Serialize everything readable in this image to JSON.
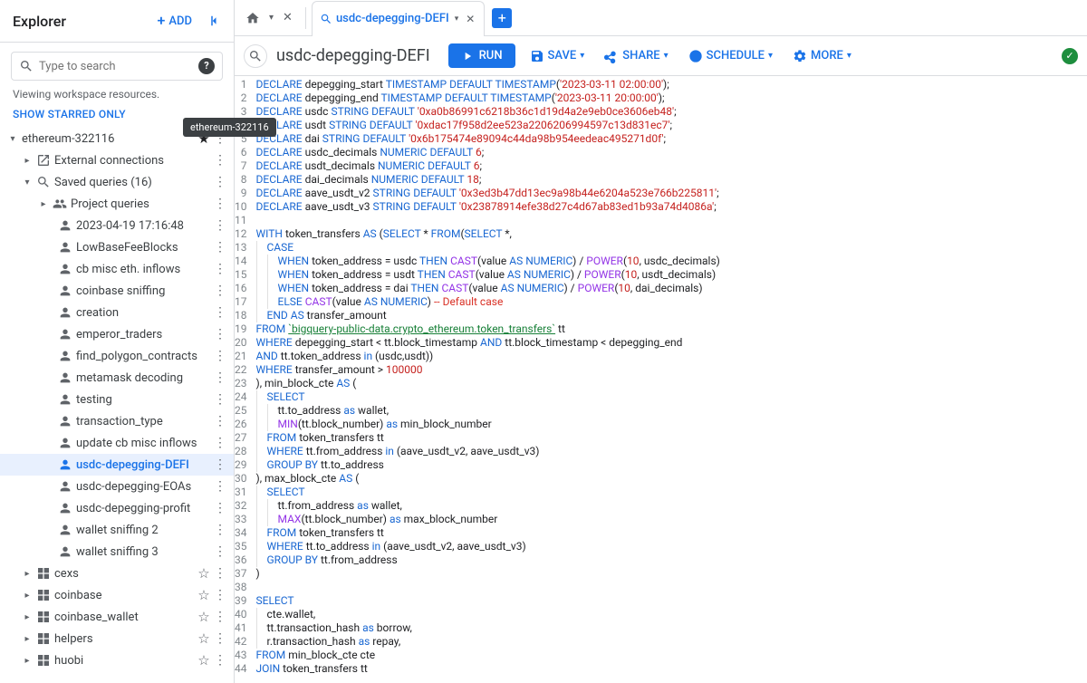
{
  "sidebar": {
    "title": "Explorer",
    "add_label": "ADD",
    "search_placeholder": "Type to search",
    "meta": "Viewing workspace resources.",
    "show_starred": "SHOW STARRED ONLY",
    "tooltip": "ethereum-322116",
    "project": {
      "label": "ethereum-322116",
      "external": "External connections",
      "saved": "Saved queries (16)",
      "proj_queries": "Project queries",
      "queries": [
        "2023-04-19 17:16:48",
        "LowBaseFeeBlocks",
        "cb misc eth. inflows",
        "coinbase sniffing",
        "creation",
        "emperor_traders",
        "find_polygon_contracts",
        "metamask decoding",
        "testing",
        "transaction_type",
        "update cb misc inflows",
        "usdc-depegging-DEFI",
        "usdc-depegging-EOAs",
        "usdc-depegging-profit",
        "wallet sniffing 2",
        "wallet sniffing 3"
      ],
      "datasets": [
        "cexs",
        "coinbase",
        "coinbase_wallet",
        "helpers",
        "huobi"
      ]
    }
  },
  "tab": {
    "label": "usdc-depegging-DEFI"
  },
  "toolbar": {
    "title": "usdc-depegging-DEFI",
    "run": "RUN",
    "save": "SAVE",
    "share": "SHARE",
    "schedule": "SCHEDULE",
    "more": "MORE"
  },
  "code": {
    "lines": [
      [
        [
          "kw",
          "DECLARE"
        ],
        [
          "id",
          " depegging_start "
        ],
        [
          "type",
          "TIMESTAMP"
        ],
        [
          "id",
          " "
        ],
        [
          "kw",
          "DEFAULT"
        ],
        [
          "id",
          " "
        ],
        [
          "type",
          "TIMESTAMP"
        ],
        [
          "id",
          "("
        ],
        [
          "str",
          "'2023-03-11 02:00:00'"
        ],
        [
          "id",
          ");"
        ]
      ],
      [
        [
          "kw",
          "DECLARE"
        ],
        [
          "id",
          " depegging_end "
        ],
        [
          "type",
          "TIMESTAMP"
        ],
        [
          "id",
          " "
        ],
        [
          "kw",
          "DEFAULT"
        ],
        [
          "id",
          " "
        ],
        [
          "type",
          "TIMESTAMP"
        ],
        [
          "id",
          "("
        ],
        [
          "str",
          "'2023-03-11 20:00:00'"
        ],
        [
          "id",
          ");"
        ]
      ],
      [
        [
          "kw",
          "DECLARE"
        ],
        [
          "id",
          " usdc "
        ],
        [
          "type",
          "STRING"
        ],
        [
          "id",
          " "
        ],
        [
          "kw",
          "DEFAULT"
        ],
        [
          "id",
          " "
        ],
        [
          "str",
          "'0xa0b86991c6218b36c1d19d4a2e9eb0ce3606eb48'"
        ],
        [
          "id",
          ";"
        ]
      ],
      [
        [
          "kw",
          "DECLARE"
        ],
        [
          "id",
          " usdt "
        ],
        [
          "type",
          "STRING"
        ],
        [
          "id",
          " "
        ],
        [
          "kw",
          "DEFAULT"
        ],
        [
          "id",
          " "
        ],
        [
          "str",
          "'0xdac17f958d2ee523a2206206994597c13d831ec7'"
        ],
        [
          "id",
          ";"
        ]
      ],
      [
        [
          "kw",
          "DECLARE"
        ],
        [
          "id",
          " dai "
        ],
        [
          "type",
          "STRING"
        ],
        [
          "id",
          " "
        ],
        [
          "kw",
          "DEFAULT"
        ],
        [
          "id",
          " "
        ],
        [
          "str",
          "'0x6b175474e89094c44da98b954eedeac495271d0f'"
        ],
        [
          "id",
          ";"
        ]
      ],
      [
        [
          "kw",
          "DECLARE"
        ],
        [
          "id",
          " usdc_decimals "
        ],
        [
          "type",
          "NUMERIC"
        ],
        [
          "id",
          " "
        ],
        [
          "kw",
          "DEFAULT"
        ],
        [
          "id",
          " "
        ],
        [
          "num",
          "6"
        ],
        [
          "id",
          ";"
        ]
      ],
      [
        [
          "kw",
          "DECLARE"
        ],
        [
          "id",
          " usdt_decimals "
        ],
        [
          "type",
          "NUMERIC"
        ],
        [
          "id",
          " "
        ],
        [
          "kw",
          "DEFAULT"
        ],
        [
          "id",
          " "
        ],
        [
          "num",
          "6"
        ],
        [
          "id",
          ";"
        ]
      ],
      [
        [
          "kw",
          "DECLARE"
        ],
        [
          "id",
          " dai_decimals "
        ],
        [
          "type",
          "NUMERIC"
        ],
        [
          "id",
          " "
        ],
        [
          "kw",
          "DEFAULT"
        ],
        [
          "id",
          " "
        ],
        [
          "num",
          "18"
        ],
        [
          "id",
          ";"
        ]
      ],
      [
        [
          "kw",
          "DECLARE"
        ],
        [
          "id",
          " aave_usdt_v2 "
        ],
        [
          "type",
          "STRING"
        ],
        [
          "id",
          " "
        ],
        [
          "kw",
          "DEFAULT"
        ],
        [
          "id",
          " "
        ],
        [
          "str",
          "'0x3ed3b47dd13ec9a98b44e6204a523e766b225811'"
        ],
        [
          "id",
          ";"
        ]
      ],
      [
        [
          "kw",
          "DECLARE"
        ],
        [
          "id",
          " aave_usdt_v3 "
        ],
        [
          "type",
          "STRING"
        ],
        [
          "id",
          " "
        ],
        [
          "kw",
          "DEFAULT"
        ],
        [
          "id",
          " "
        ],
        [
          "str",
          "'0x23878914efe38d27c4d67ab83ed1b93a74d4086a'"
        ],
        [
          "id",
          ";"
        ]
      ],
      [],
      [
        [
          "kw",
          "WITH"
        ],
        [
          "id",
          " token_transfers "
        ],
        [
          "kw",
          "AS"
        ],
        [
          "id",
          " ("
        ],
        [
          "kw",
          "SELECT"
        ],
        [
          "id",
          " * "
        ],
        [
          "kw",
          "FROM"
        ],
        [
          "id",
          "("
        ],
        [
          "kw",
          "SELECT"
        ],
        [
          "id",
          " *,"
        ]
      ],
      [
        [
          "ind",
          1
        ],
        [
          "kw",
          "CASE"
        ]
      ],
      [
        [
          "ind",
          2
        ],
        [
          "kw",
          "WHEN"
        ],
        [
          "id",
          " token_address = usdc "
        ],
        [
          "kw",
          "THEN"
        ],
        [
          "id",
          " "
        ],
        [
          "fn",
          "CAST"
        ],
        [
          "id",
          "(value "
        ],
        [
          "kw",
          "AS"
        ],
        [
          "id",
          " "
        ],
        [
          "type",
          "NUMERIC"
        ],
        [
          "id",
          ") / "
        ],
        [
          "fn",
          "POWER"
        ],
        [
          "id",
          "("
        ],
        [
          "num",
          "10"
        ],
        [
          "id",
          ", usdc_decimals)"
        ]
      ],
      [
        [
          "ind",
          2
        ],
        [
          "kw",
          "WHEN"
        ],
        [
          "id",
          " token_address = usdt "
        ],
        [
          "kw",
          "THEN"
        ],
        [
          "id",
          " "
        ],
        [
          "fn",
          "CAST"
        ],
        [
          "id",
          "(value "
        ],
        [
          "kw",
          "AS"
        ],
        [
          "id",
          " "
        ],
        [
          "type",
          "NUMERIC"
        ],
        [
          "id",
          ") / "
        ],
        [
          "fn",
          "POWER"
        ],
        [
          "id",
          "("
        ],
        [
          "num",
          "10"
        ],
        [
          "id",
          ", usdt_decimals)"
        ]
      ],
      [
        [
          "ind",
          2
        ],
        [
          "kw",
          "WHEN"
        ],
        [
          "id",
          " token_address = dai "
        ],
        [
          "kw",
          "THEN"
        ],
        [
          "id",
          " "
        ],
        [
          "fn",
          "CAST"
        ],
        [
          "id",
          "(value "
        ],
        [
          "kw",
          "AS"
        ],
        [
          "id",
          " "
        ],
        [
          "type",
          "NUMERIC"
        ],
        [
          "id",
          ") / "
        ],
        [
          "fn",
          "POWER"
        ],
        [
          "id",
          "("
        ],
        [
          "num",
          "10"
        ],
        [
          "id",
          ", dai_decimals)"
        ]
      ],
      [
        [
          "ind",
          2
        ],
        [
          "kw",
          "ELSE"
        ],
        [
          "id",
          " "
        ],
        [
          "fn",
          "CAST"
        ],
        [
          "id",
          "(value "
        ],
        [
          "kw",
          "AS"
        ],
        [
          "id",
          " "
        ],
        [
          "type",
          "NUMERIC"
        ],
        [
          "id",
          ") "
        ],
        [
          "cmt",
          "-- Default case"
        ]
      ],
      [
        [
          "ind",
          1
        ],
        [
          "kw",
          "END"
        ],
        [
          "id",
          " "
        ],
        [
          "kw",
          "AS"
        ],
        [
          "id",
          " transfer_amount"
        ]
      ],
      [
        [
          "kw",
          "FROM"
        ],
        [
          "id",
          " "
        ],
        [
          "link",
          "`bigquery-public-data.crypto_ethereum.token_transfers`"
        ],
        [
          "id",
          " tt"
        ]
      ],
      [
        [
          "kw",
          "WHERE"
        ],
        [
          "id",
          " depegging_start < tt.block_timestamp "
        ],
        [
          "kw",
          "AND"
        ],
        [
          "id",
          " tt.block_timestamp < depegging_end"
        ]
      ],
      [
        [
          "kw",
          "AND"
        ],
        [
          "id",
          " tt.token_address "
        ],
        [
          "kw",
          "in"
        ],
        [
          "id",
          " (usdc,usdt))"
        ]
      ],
      [
        [
          "kw",
          "WHERE"
        ],
        [
          "id",
          " transfer_amount > "
        ],
        [
          "num",
          "100000"
        ]
      ],
      [
        [
          "id",
          ")"
        ],
        [
          "id",
          ", min_block_cte "
        ],
        [
          "kw",
          "AS"
        ],
        [
          "id",
          " ("
        ]
      ],
      [
        [
          "ind",
          1
        ],
        [
          "kw",
          "SELECT"
        ]
      ],
      [
        [
          "ind",
          2
        ],
        [
          "id",
          "tt.to_address "
        ],
        [
          "kw",
          "as"
        ],
        [
          "id",
          " wallet,"
        ]
      ],
      [
        [
          "ind",
          2
        ],
        [
          "fn",
          "MIN"
        ],
        [
          "id",
          "(tt.block_number) "
        ],
        [
          "kw",
          "as"
        ],
        [
          "id",
          " min_block_number"
        ]
      ],
      [
        [
          "ind",
          1
        ],
        [
          "kw",
          "FROM"
        ],
        [
          "id",
          " token_transfers tt"
        ]
      ],
      [
        [
          "ind",
          1
        ],
        [
          "kw",
          "WHERE"
        ],
        [
          "id",
          " tt.from_address "
        ],
        [
          "kw",
          "in"
        ],
        [
          "id",
          " (aave_usdt_v2, aave_usdt_v3)"
        ]
      ],
      [
        [
          "ind",
          1
        ],
        [
          "kw",
          "GROUP BY"
        ],
        [
          "id",
          " tt.to_address"
        ]
      ],
      [
        [
          "id",
          ")"
        ],
        [
          "id",
          ", max_block_cte "
        ],
        [
          "kw",
          "AS"
        ],
        [
          "id",
          " ("
        ]
      ],
      [
        [
          "ind",
          1
        ],
        [
          "kw",
          "SELECT"
        ]
      ],
      [
        [
          "ind",
          2
        ],
        [
          "id",
          "tt.from_address "
        ],
        [
          "kw",
          "as"
        ],
        [
          "id",
          " wallet,"
        ]
      ],
      [
        [
          "ind",
          2
        ],
        [
          "fn",
          "MAX"
        ],
        [
          "id",
          "(tt.block_number) "
        ],
        [
          "kw",
          "as"
        ],
        [
          "id",
          " max_block_number"
        ]
      ],
      [
        [
          "ind",
          1
        ],
        [
          "kw",
          "FROM"
        ],
        [
          "id",
          " token_transfers tt"
        ]
      ],
      [
        [
          "ind",
          1
        ],
        [
          "kw",
          "WHERE"
        ],
        [
          "id",
          " tt.to_address "
        ],
        [
          "kw",
          "in"
        ],
        [
          "id",
          " (aave_usdt_v2, aave_usdt_v3)"
        ]
      ],
      [
        [
          "ind",
          1
        ],
        [
          "kw",
          "GROUP BY"
        ],
        [
          "id",
          " tt.from_address"
        ]
      ],
      [
        [
          "id",
          ")"
        ]
      ],
      [],
      [
        [
          "kw",
          "SELECT"
        ]
      ],
      [
        [
          "ind",
          1
        ],
        [
          "id",
          "cte.wallet,"
        ]
      ],
      [
        [
          "ind",
          1
        ],
        [
          "id",
          "tt.transaction_hash "
        ],
        [
          "kw",
          "as"
        ],
        [
          "id",
          " borrow,"
        ]
      ],
      [
        [
          "ind",
          1
        ],
        [
          "id",
          "r.transaction_hash "
        ],
        [
          "kw",
          "as"
        ],
        [
          "id",
          " repay,"
        ]
      ],
      [
        [
          "kw",
          "FROM"
        ],
        [
          "id",
          " min_block_cte cte"
        ]
      ],
      [
        [
          "kw",
          "JOIN"
        ],
        [
          "id",
          " token_transfers tt"
        ]
      ]
    ]
  }
}
